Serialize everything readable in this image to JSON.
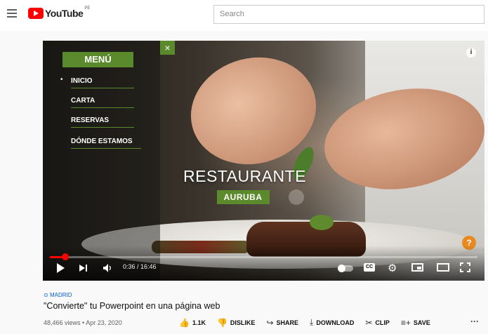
{
  "header": {
    "logo_text": "YouTube",
    "logo_region": "PE",
    "search_placeholder": "Search"
  },
  "video": {
    "menu": {
      "title": "MENÚ",
      "close": "×",
      "items": [
        "INICIO",
        "CARTA",
        "RESERVAS",
        "DÓNDE ESTAMOS"
      ],
      "active_bullet": "•"
    },
    "overlay_title": "RESTAURANTE",
    "overlay_subtitle": "AURUBA",
    "info_glyph": "i",
    "badge_glyph": "?",
    "time": "0:36 / 16:46",
    "progress": 0.036,
    "cc_label": "CC"
  },
  "details": {
    "location": "MADRID",
    "title": "\"Convierte\" tu Powerpoint en una página web",
    "meta": "48,466 views • Apr 23, 2020",
    "actions": [
      {
        "icon": "like-icon",
        "glyph": "👍",
        "label": "1.1K"
      },
      {
        "icon": "dislike-icon",
        "glyph": "👎",
        "label": "DISLIKE"
      },
      {
        "icon": "share-icon",
        "glyph": "↪",
        "label": "SHARE"
      },
      {
        "icon": "download-icon",
        "glyph": "⤓",
        "label": "DOWNLOAD"
      },
      {
        "icon": "clip-icon",
        "glyph": "✂",
        "label": "CLIP"
      },
      {
        "icon": "save-icon",
        "glyph": "≡+",
        "label": "SAVE"
      }
    ],
    "more": "···"
  },
  "colors": {
    "accent_green": "#5a8a2b",
    "youtube_red": "#ff0000",
    "link_blue": "#065fd4"
  }
}
